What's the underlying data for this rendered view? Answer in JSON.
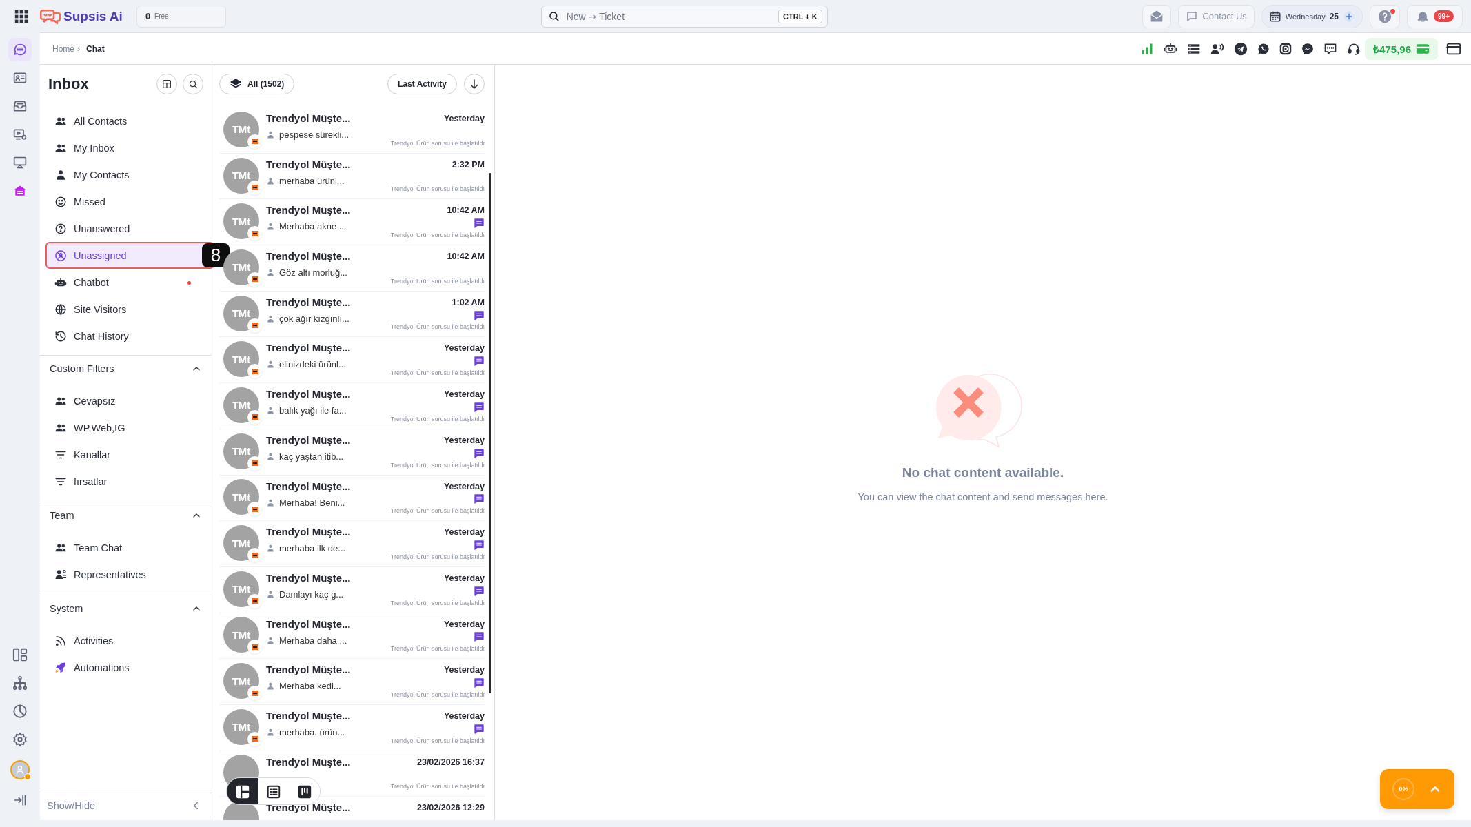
{
  "top_bar": {
    "logo": "Supsis Ai",
    "credits": {
      "count": "0",
      "label": "Free"
    },
    "search": {
      "placeholder": "New ⇥ Ticket",
      "shortcut": "CTRL + K"
    },
    "contact_button": "Contact Us",
    "date": {
      "weekday": "Wednesday",
      "day": "25"
    },
    "help_alert": true,
    "notifications": "99+"
  },
  "rail": {
    "items": [
      {
        "selected": true
      },
      {
        "selected": false
      },
      {
        "selected": false
      },
      {
        "selected": false
      },
      {
        "selected": false
      },
      {
        "selected": false
      }
    ]
  },
  "breadcrumb": {
    "separator": "›",
    "items": [
      {
        "label": "Home",
        "current": false
      },
      {
        "label": "Chat",
        "current": true
      }
    ]
  },
  "channels_bar": {
    "balance": "₺475,96"
  },
  "inbox": {
    "title": "Inbox",
    "items": [
      {
        "label": "All Contacts",
        "selected": false,
        "alert": false
      },
      {
        "label": "My Inbox",
        "selected": false,
        "alert": false
      },
      {
        "label": "My Contacts",
        "selected": false,
        "alert": false
      },
      {
        "label": "Missed",
        "selected": false,
        "alert": false
      },
      {
        "label": "Unanswered",
        "selected": false,
        "alert": false
      },
      {
        "label": "Unassigned",
        "selected": true,
        "alert": false,
        "marker": "8"
      },
      {
        "label": "Chatbot",
        "selected": false,
        "alert": true
      },
      {
        "label": "Site Visitors",
        "selected": false,
        "alert": false
      },
      {
        "label": "Chat History",
        "selected": false,
        "alert": false
      }
    ],
    "sections": [
      {
        "title": "Custom Filters",
        "expanded": true,
        "items": [
          {
            "label": "Cevapsız"
          },
          {
            "label": "WP,Web,IG"
          },
          {
            "label": "Kanallar"
          },
          {
            "label": "fırsatlar"
          }
        ]
      },
      {
        "title": "Team",
        "expanded": true,
        "items": [
          {
            "label": "Team Chat"
          },
          {
            "label": "Representatives"
          }
        ]
      },
      {
        "title": "System",
        "expanded": true,
        "items": [
          {
            "label": "Activities"
          },
          {
            "label": "Automations"
          }
        ]
      }
    ],
    "footer": "Show/Hide"
  },
  "chat_list": {
    "filter": "All (1502)",
    "sort": "Last Activity",
    "rows": [
      {
        "initials": "TMt",
        "name": "Trendyol Müşte...",
        "preview": "pespese sürekli...",
        "time": "Yesterday",
        "unread": false,
        "note": "Trendyol Ürün sorusu ile başlatıldı"
      },
      {
        "initials": "TMt",
        "name": "Trendyol Müşte...",
        "preview": "merhaba ürünl...",
        "time": "2:32 PM",
        "unread": false,
        "note": "Trendyol Ürün sorusu ile başlatıldı"
      },
      {
        "initials": "TMt",
        "name": "Trendyol Müşte...",
        "preview": "Merhaba akne ...",
        "time": "10:42 AM",
        "unread": true,
        "note": "Trendyol Ürün sorusu ile başlatıldı"
      },
      {
        "initials": "TMt",
        "name": "Trendyol Müşte...",
        "preview": "Göz altı morluğ...",
        "time": "10:42 AM",
        "unread": false,
        "note": "Trendyol Ürün sorusu ile başlatıldı"
      },
      {
        "initials": "TMt",
        "name": "Trendyol Müşte...",
        "preview": "çok ağır kızgınlı...",
        "time": "1:02 AM",
        "unread": true,
        "note": "Trendyol Ürün sorusu ile başlatıldı"
      },
      {
        "initials": "TMt",
        "name": "Trendyol Müşte...",
        "preview": "elinizdeki ürünl...",
        "time": "Yesterday",
        "unread": true,
        "note": "Trendyol Ürün sorusu ile başlatıldı"
      },
      {
        "initials": "TMt",
        "name": "Trendyol Müşte...",
        "preview": "balık yağı ile fa...",
        "time": "Yesterday",
        "unread": true,
        "note": "Trendyol Ürün sorusu ile başlatıldı"
      },
      {
        "initials": "TMt",
        "name": "Trendyol Müşte...",
        "preview": "kaç yaştan itib...",
        "time": "Yesterday",
        "unread": true,
        "note": "Trendyol Ürün sorusu ile başlatıldı"
      },
      {
        "initials": "TMt",
        "name": "Trendyol Müşte...",
        "preview": "Merhaba! Beni...",
        "time": "Yesterday",
        "unread": true,
        "note": "Trendyol Ürün sorusu ile başlatıldı"
      },
      {
        "initials": "TMt",
        "name": "Trendyol Müşte...",
        "preview": "merhaba ilk de...",
        "time": "Yesterday",
        "unread": true,
        "note": "Trendyol Ürün sorusu ile başlatıldı"
      },
      {
        "initials": "TMt",
        "name": "Trendyol Müşte...",
        "preview": "Damlayı kaç g...",
        "time": "Yesterday",
        "unread": true,
        "note": "Trendyol Ürün sorusu ile başlatıldı"
      },
      {
        "initials": "TMt",
        "name": "Trendyol Müşte...",
        "preview": "Merhaba daha ...",
        "time": "Yesterday",
        "unread": true,
        "note": "Trendyol Ürün sorusu ile başlatıldı"
      },
      {
        "initials": "TMt",
        "name": "Trendyol Müşte...",
        "preview": "Merhaba kedi...",
        "time": "Yesterday",
        "unread": true,
        "note": "Trendyol Ürün sorusu ile başlatıldı"
      },
      {
        "initials": "TMt",
        "name": "Trendyol Müşte...",
        "preview": "merhaba. ürün...",
        "time": "Yesterday",
        "unread": true,
        "note": "Trendyol Ürün sorusu ile başlatıldı"
      },
      {
        "name": "Trendyol Müşte...",
        "time": "23/02/2026 16:37",
        "unread": false,
        "note": "Trendyol Ürün sorusu ile başlatıldı"
      },
      {
        "name": "Trendyol Müşte...",
        "time": "23/02/2026 12:29",
        "unread": false
      }
    ],
    "view_modes": [
      {
        "selected": true
      },
      {
        "selected": false
      },
      {
        "selected": false
      }
    ]
  },
  "empty_state": {
    "title": "No chat content available.",
    "text": "You can view the chat content and send messages here."
  },
  "progress_widget": {
    "label": "0%"
  }
}
